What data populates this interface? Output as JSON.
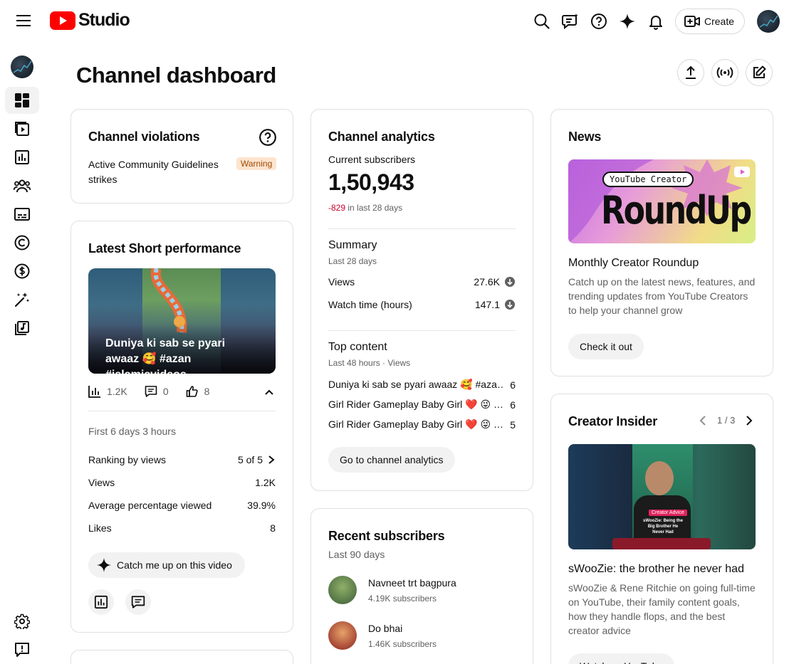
{
  "header": {
    "logo_text": "Studio",
    "create_label": "Create"
  },
  "page": {
    "title": "Channel dashboard"
  },
  "violations": {
    "title": "Channel violations",
    "text": "Active Community Guidelines strikes",
    "badge": "Warning"
  },
  "short_perf": {
    "title": "Latest Short performance",
    "video_title": "Duniya ki sab se pyari awaaz 🥰 #azan #islamicvideos…",
    "views": "1.2K",
    "comments": "0",
    "likes": "8",
    "period": "First 6 days 3 hours",
    "stats": [
      {
        "label": "Ranking by views",
        "value": "5 of 5"
      },
      {
        "label": "Views",
        "value": "1.2K"
      },
      {
        "label": "Average percentage viewed",
        "value": "39.9%"
      },
      {
        "label": "Likes",
        "value": "8"
      }
    ],
    "catch_up_label": "Catch me up on this video"
  },
  "analytics": {
    "title": "Channel analytics",
    "subs_label": "Current subscribers",
    "subs_value": "1,50,943",
    "subs_change": "-829",
    "subs_change_suffix": "in last 28 days",
    "summary_title": "Summary",
    "summary_period": "Last 28 days",
    "summary": [
      {
        "label": "Views",
        "value": "27.6K"
      },
      {
        "label": "Watch time (hours)",
        "value": "147.1"
      }
    ],
    "top_title": "Top content",
    "top_period": "Last 48 hours · Views",
    "top": [
      {
        "title": "Duniya ki sab se pyari awaaz 🥰 #aza…",
        "value": "6"
      },
      {
        "title": "Girl Rider Gameplay Baby Girl ❤️ 😜 …",
        "value": "6"
      },
      {
        "title": "Girl Rider Gameplay Baby Girl ❤️ 😜 …",
        "value": "5"
      }
    ],
    "button": "Go to channel analytics"
  },
  "recent_subs": {
    "title": "Recent subscribers",
    "period": "Last 90 days",
    "items": [
      {
        "name": "Navneet trt bagpura",
        "subs": "4.19K subscribers"
      },
      {
        "name": "Do bhai",
        "subs": "1.46K subscribers"
      }
    ]
  },
  "news": {
    "title": "News",
    "img_tag": "YouTube Creator",
    "img_headline": "RoundUp",
    "item_title": "Monthly Creator Roundup",
    "item_desc": "Catch up on the latest news, features, and trending updates from YouTube Creators to help your channel grow",
    "button": "Check it out"
  },
  "insider": {
    "title": "Creator Insider",
    "pager": "1 / 3",
    "img_tag": "Creator Advice",
    "img_caption": "sWooZie: Being the Big Brother He Never Had",
    "item_title": "sWooZie: the brother he never had",
    "item_desc": "sWooZie & Rene Ritchie on going full-time on YouTube, their family content goals, how they handle flops, and the best creator advice",
    "button": "Watch on YouTube"
  },
  "colors": {
    "youtube_red": "#ff0000",
    "warning_bg": "#fde4cf",
    "warning_text": "#a04a00",
    "negative": "#cc0033"
  }
}
